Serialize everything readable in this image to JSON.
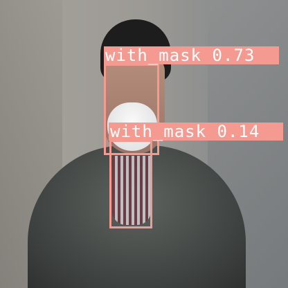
{
  "detections": [
    {
      "label": "with_mask 0.73",
      "class": "with_mask",
      "confidence": 0.73
    },
    {
      "label": "with_mask 0.14",
      "class": "with_mask",
      "confidence": 0.14
    }
  ],
  "colors": {
    "box": "#f59a90",
    "label_text": "#ffffff"
  }
}
